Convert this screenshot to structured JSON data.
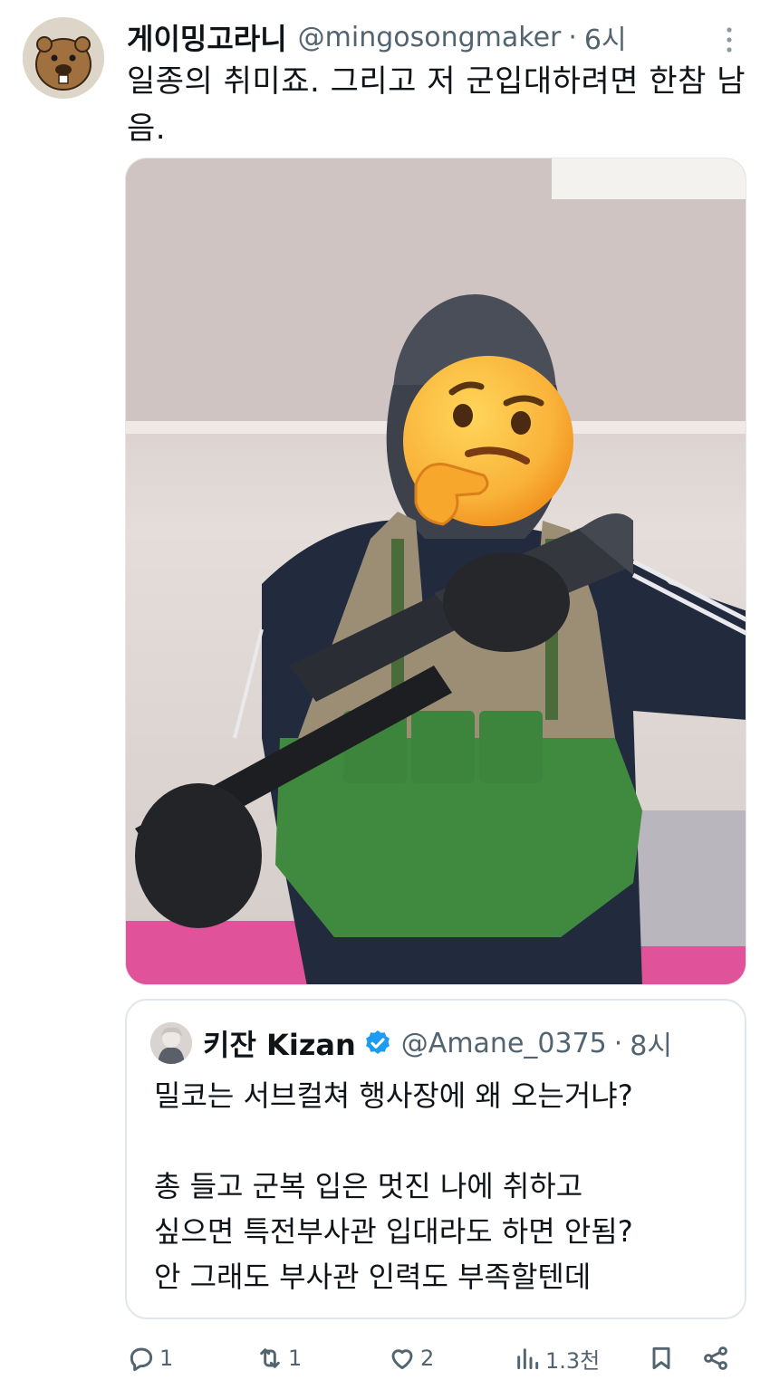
{
  "tweet": {
    "display_name": "게이밍고라니",
    "handle": "@mingosongmaker",
    "separator": "·",
    "time": "6시",
    "text": "일종의 취미죠. 그리고 저 군입대하려면 한참 남음."
  },
  "quote": {
    "display_name": "키잔 Kizan",
    "handle": "@Amane_0375",
    "separator": "·",
    "time": "8시",
    "text": "밀코는 서브컬쳐 행사장에 왜 오는거냐?\n\n총 들고 군복 입은 멋진 나에 취하고\n싶으면 특전부사관 입대라도 하면 안됨?\n안 그래도 부사관 인력도 부족할텐데"
  },
  "actions": {
    "replies": "1",
    "retweets": "1",
    "likes": "2",
    "views": "1.3천"
  },
  "icons": {
    "more": "more-vertical-icon",
    "verified": "verified-badge-icon",
    "reply": "reply-icon",
    "retweet": "retweet-icon",
    "like": "heart-icon",
    "views": "views-chart-icon",
    "bookmark": "bookmark-icon",
    "share": "share-icon"
  },
  "colors": {
    "text": "#0f1419",
    "muted": "#536471",
    "verified": "#1d9bf0",
    "border": "#e1e8ed"
  }
}
